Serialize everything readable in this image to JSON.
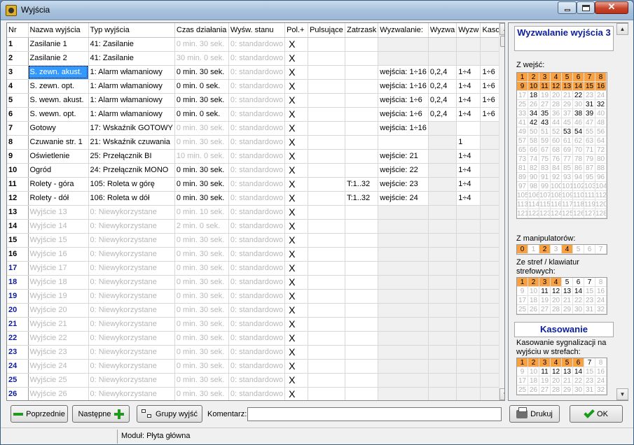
{
  "window": {
    "title": "Wyjścia"
  },
  "table": {
    "columns": [
      "Nr",
      "Nazwa wyjścia",
      "Typ wyjścia",
      "Czas działania",
      "Wyśw. stanu",
      "Pol.+",
      "Pulsujące",
      "Zatrzask",
      "Wyzwalanie:",
      "Wyzwa",
      "Wyzw",
      "Kaso"
    ],
    "rows": [
      {
        "nr": "1",
        "name": "Zasilanie 1",
        "type": "41: Zasilanie",
        "time": "0 min. 30 sek.",
        "state": "0: standardowo",
        "pol": "X",
        "puls": "",
        "latch": "",
        "trig": "",
        "w1": "",
        "w2": "",
        "reset": ""
      },
      {
        "nr": "2",
        "name": "Zasilanie 2",
        "type": "41: Zasilanie",
        "time": "30 min. 0 sek.",
        "state": "0: standardowo",
        "pol": "X",
        "puls": "",
        "latch": "",
        "trig": "",
        "w1": "",
        "w2": "",
        "reset": ""
      },
      {
        "nr": "3",
        "name": "S. zewn. akust.",
        "type": "1: Alarm włamaniowy",
        "time": "0 min. 30 sek.",
        "state": "0: standardowo",
        "pol": "X",
        "puls": "",
        "latch": "",
        "trig": "wejścia: 1÷16",
        "w1": "0,2,4",
        "w2": "1÷4",
        "reset": "1÷6"
      },
      {
        "nr": "4",
        "name": "S. zewn. opt.",
        "type": "1: Alarm włamaniowy",
        "time": "0 min. 0 sek.",
        "state": "0: standardowo",
        "pol": "X",
        "puls": "",
        "latch": "",
        "trig": "wejścia: 1÷16",
        "w1": "0,2,4",
        "w2": "1÷4",
        "reset": "1÷6"
      },
      {
        "nr": "5",
        "name": "S. wewn. akust.",
        "type": "1: Alarm włamaniowy",
        "time": "0 min. 30 sek.",
        "state": "0: standardowo",
        "pol": "X",
        "puls": "",
        "latch": "",
        "trig": "wejścia: 1÷6",
        "w1": "0,2,4",
        "w2": "1÷4",
        "reset": "1÷6"
      },
      {
        "nr": "6",
        "name": "S. wewn. opt.",
        "type": "1: Alarm włamaniowy",
        "time": "0 min. 0 sek.",
        "state": "0: standardowo",
        "pol": "X",
        "puls": "",
        "latch": "",
        "trig": "wejścia: 1÷6",
        "w1": "0,2,4",
        "w2": "1÷4",
        "reset": "1÷6"
      },
      {
        "nr": "7",
        "name": "Gotowy",
        "type": "17: Wskaźnik GOTOWY",
        "time": "0 min. 30 sek.",
        "state": "0: standardowo",
        "pol": "X",
        "puls": "",
        "latch": "",
        "trig": "wejścia: 1÷16",
        "w1": "",
        "w2": "",
        "reset": ""
      },
      {
        "nr": "8",
        "name": "Czuwanie str. 1",
        "type": "21: Wskaźnik czuwania",
        "time": "0 min. 30 sek.",
        "state": "0: standardowo",
        "pol": "X",
        "puls": "",
        "latch": "",
        "trig": "",
        "w1": "",
        "w2": "1",
        "reset": ""
      },
      {
        "nr": "9",
        "name": "Oświetlenie",
        "type": "25: Przełącznik BI",
        "time": "10 min. 0 sek.",
        "state": "0: standardowo",
        "pol": "X",
        "puls": "",
        "latch": "",
        "trig": "wejście: 21",
        "w1": "",
        "w2": "1÷4",
        "reset": ""
      },
      {
        "nr": "10",
        "name": "Ogród",
        "type": "24: Przełącznik MONO",
        "time": "0 min. 30 sek.",
        "state": "0: standardowo",
        "pol": "X",
        "puls": "",
        "latch": "",
        "trig": "wejście: 22",
        "w1": "",
        "w2": "1÷4",
        "reset": ""
      },
      {
        "nr": "11",
        "name": "Rolety - góra",
        "type": "105: Roleta w górę",
        "time": "0 min. 30 sek.",
        "state": "0: standardowo",
        "pol": "X",
        "puls": "",
        "latch": "T:1..32",
        "trig": "wejście: 23",
        "w1": "",
        "w2": "1÷4",
        "reset": ""
      },
      {
        "nr": "12",
        "name": "Rolety - dół",
        "type": "106: Roleta w dół",
        "time": "0 min. 30 sek.",
        "state": "0: standardowo",
        "pol": "X",
        "puls": "",
        "latch": "T:1..32",
        "trig": "wejście: 24",
        "w1": "",
        "w2": "1÷4",
        "reset": ""
      },
      {
        "nr": "13",
        "name": "Wyjście 13",
        "type": "0: Niewykorzystane",
        "time": "0 min. 10 sek.",
        "state": "0: standardowo",
        "pol": "X",
        "puls": "",
        "latch": "",
        "trig": "",
        "w1": "",
        "w2": "",
        "reset": ""
      },
      {
        "nr": "14",
        "name": "Wyjście 14",
        "type": "0: Niewykorzystane",
        "time": "2 min. 0 sek.",
        "state": "0: standardowo",
        "pol": "X",
        "puls": "",
        "latch": "",
        "trig": "",
        "w1": "",
        "w2": "",
        "reset": ""
      },
      {
        "nr": "15",
        "name": "Wyjście 15",
        "type": "0: Niewykorzystane",
        "time": "0 min. 30 sek.",
        "state": "0: standardowo",
        "pol": "X",
        "puls": "",
        "latch": "",
        "trig": "",
        "w1": "",
        "w2": "",
        "reset": ""
      },
      {
        "nr": "16",
        "name": "Wyjście 16",
        "type": "0: Niewykorzystane",
        "time": "0 min. 30 sek.",
        "state": "0: standardowo",
        "pol": "X",
        "puls": "",
        "latch": "",
        "trig": "",
        "w1": "",
        "w2": "",
        "reset": ""
      },
      {
        "nr": "17",
        "name": "Wyjście 17",
        "type": "0: Niewykorzystane",
        "time": "0 min. 30 sek.",
        "state": "0: standardowo",
        "pol": "X",
        "puls": "",
        "latch": "",
        "trig": "",
        "w1": "",
        "w2": "",
        "reset": ""
      },
      {
        "nr": "18",
        "name": "Wyjście 18",
        "type": "0: Niewykorzystane",
        "time": "0 min. 30 sek.",
        "state": "0: standardowo",
        "pol": "X",
        "puls": "",
        "latch": "",
        "trig": "",
        "w1": "",
        "w2": "",
        "reset": ""
      },
      {
        "nr": "19",
        "name": "Wyjście 19",
        "type": "0: Niewykorzystane",
        "time": "0 min. 30 sek.",
        "state": "0: standardowo",
        "pol": "X",
        "puls": "",
        "latch": "",
        "trig": "",
        "w1": "",
        "w2": "",
        "reset": ""
      },
      {
        "nr": "20",
        "name": "Wyjście 20",
        "type": "0: Niewykorzystane",
        "time": "0 min. 30 sek.",
        "state": "0: standardowo",
        "pol": "X",
        "puls": "",
        "latch": "",
        "trig": "",
        "w1": "",
        "w2": "",
        "reset": ""
      },
      {
        "nr": "21",
        "name": "Wyjście 21",
        "type": "0: Niewykorzystane",
        "time": "0 min. 30 sek.",
        "state": "0: standardowo",
        "pol": "X",
        "puls": "",
        "latch": "",
        "trig": "",
        "w1": "",
        "w2": "",
        "reset": ""
      },
      {
        "nr": "22",
        "name": "Wyjście 22",
        "type": "0: Niewykorzystane",
        "time": "0 min. 30 sek.",
        "state": "0: standardowo",
        "pol": "X",
        "puls": "",
        "latch": "",
        "trig": "",
        "w1": "",
        "w2": "",
        "reset": ""
      },
      {
        "nr": "23",
        "name": "Wyjście 23",
        "type": "0: Niewykorzystane",
        "time": "0 min. 30 sek.",
        "state": "0: standardowo",
        "pol": "X",
        "puls": "",
        "latch": "",
        "trig": "",
        "w1": "",
        "w2": "",
        "reset": ""
      },
      {
        "nr": "24",
        "name": "Wyjście 24",
        "type": "0: Niewykorzystane",
        "time": "0 min. 30 sek.",
        "state": "0: standardowo",
        "pol": "X",
        "puls": "",
        "latch": "",
        "trig": "",
        "w1": "",
        "w2": "",
        "reset": ""
      },
      {
        "nr": "25",
        "name": "Wyjście 25",
        "type": "0: Niewykorzystane",
        "time": "0 min. 30 sek.",
        "state": "0: standardowo",
        "pol": "X",
        "puls": "",
        "latch": "",
        "trig": "",
        "w1": "",
        "w2": "",
        "reset": ""
      },
      {
        "nr": "26",
        "name": "Wyjście 26",
        "type": "0: Niewykorzystane",
        "time": "0 min. 30 sek.",
        "state": "0: standardowo",
        "pol": "X",
        "puls": "",
        "latch": "",
        "trig": "",
        "w1": "",
        "w2": "",
        "reset": ""
      }
    ],
    "selected_row": 3,
    "selected_column": "name"
  },
  "panel": {
    "trigger_title": "Wyzwalanie wyjścia 3",
    "inputs_label": "Z wejść:",
    "inputs": {
      "count": 128,
      "highlighted": [
        1,
        2,
        3,
        4,
        5,
        6,
        7,
        8,
        9,
        10,
        11,
        12,
        13,
        14,
        15,
        16
      ],
      "active_black": [
        18,
        22,
        31,
        32,
        34,
        35,
        38,
        39,
        42,
        43,
        53,
        54
      ]
    },
    "keypads_label": "Z manipulatorów:",
    "keypads": {
      "values": [
        "0",
        "1",
        "2",
        "3",
        "4",
        "5",
        "6",
        "7"
      ],
      "highlighted": [
        "0",
        "2",
        "4"
      ],
      "active_black": []
    },
    "zones_label": "Ze stref / klawiatur strefowych:",
    "zones": {
      "count": 32,
      "highlighted": [
        1,
        2,
        3,
        4
      ],
      "active_black": [
        5,
        6,
        7,
        11,
        12,
        13,
        14
      ]
    },
    "reset_title": "Kasowanie",
    "reset_label": "Kasowanie sygnalizacji na wyjściu w strefach:",
    "reset_zones": {
      "count": 32,
      "highlighted": [
        1,
        2,
        3,
        4,
        5,
        6
      ],
      "active_black": [
        7,
        11,
        12,
        13,
        14
      ]
    }
  },
  "buttons": {
    "prev": "Poprzednie",
    "next": "Następne",
    "groups": "Grupy wyjść",
    "print": "Drukuj",
    "ok": "OK"
  },
  "comment": {
    "label": "Komentarz:",
    "value": ""
  },
  "status": {
    "module": "Moduł: Płyta główna"
  },
  "colors": {
    "highlight": "#f7a142",
    "selection": "#3399ff",
    "nr_blue": "#0b1d9e"
  }
}
